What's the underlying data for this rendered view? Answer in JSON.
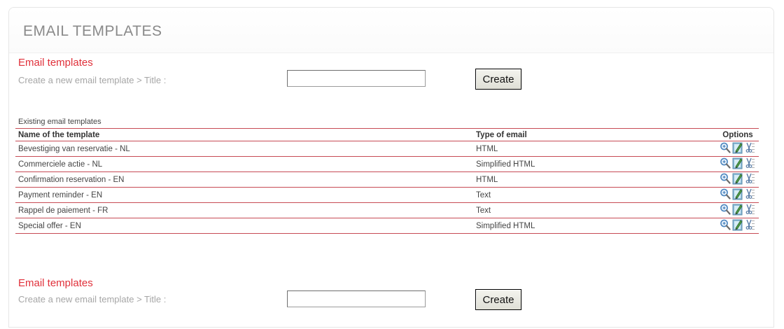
{
  "header": {
    "title": "EMAIL TEMPLATES"
  },
  "create_top": {
    "section_label": "Email templates",
    "create_label": "Create a new email template > Title :",
    "title_value": "",
    "create_button_label": "Create"
  },
  "existing": {
    "caption": "Existing email templates",
    "columns": {
      "name": "Name of the template",
      "type": "Type of email",
      "options": "Options"
    },
    "rows": [
      {
        "name": "Bevestiging van reservatie - NL",
        "type": "HTML"
      },
      {
        "name": "Commerciele actie - NL",
        "type": "Simplified HTML"
      },
      {
        "name": "Confirmation reservation - EN",
        "type": "HTML"
      },
      {
        "name": "Payment reminder - EN",
        "type": "Text"
      },
      {
        "name": "Rappel de paiement - FR",
        "type": "Text"
      },
      {
        "name": "Special offer - EN",
        "type": "Simplified HTML"
      }
    ],
    "row_icons": [
      "zoom-icon",
      "edit-icon",
      "delete-icon"
    ]
  },
  "create_bottom": {
    "section_label": "Email templates",
    "create_label": "Create a new email template > Title :",
    "title_value": "",
    "create_button_label": "Create"
  },
  "colors": {
    "accent_red": "#e0303a",
    "table_rule": "#c74b55",
    "label_grey": "#a6a6a6",
    "title_grey": "#8a8a8a"
  }
}
